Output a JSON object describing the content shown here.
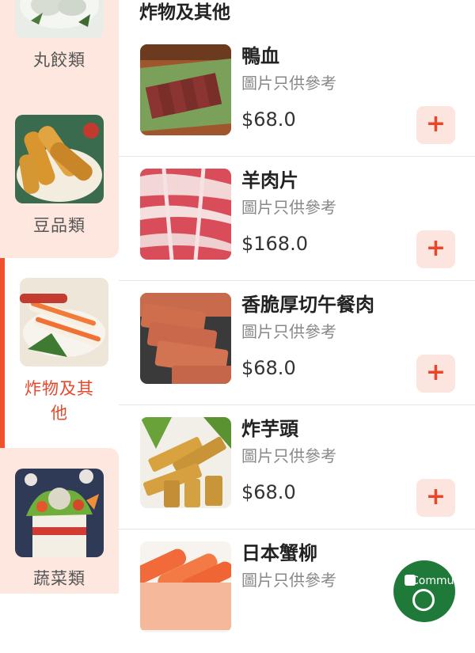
{
  "sidebar": {
    "categories": [
      {
        "label": "丸餃類"
      },
      {
        "label": "豆品類"
      },
      {
        "label": "炸物及其他"
      },
      {
        "label": "蔬菜類"
      }
    ]
  },
  "main": {
    "section_title": "炸物及其他",
    "items": [
      {
        "name": "鴨血",
        "note": "圖片只供參考",
        "price": "$68.0"
      },
      {
        "name": "羊肉片",
        "note": "圖片只供參考",
        "price": "$168.0"
      },
      {
        "name": "香脆厚切午餐肉",
        "note": "圖片只供參考",
        "price": "$68.0"
      },
      {
        "name": "炸芋頭",
        "note": "圖片只供參考",
        "price": "$68.0"
      },
      {
        "name": "日本蟹柳",
        "note": "圖片只供參考",
        "price": ""
      }
    ],
    "add_symbol": "+"
  },
  "fab": {
    "text": "Commu"
  },
  "colors": {
    "accent": "#e8472c",
    "sidebar_bg": "#fde7df",
    "add_bg": "#fde5df"
  },
  "icons": {
    "add": "plus-icon",
    "fab": "community-icon"
  }
}
